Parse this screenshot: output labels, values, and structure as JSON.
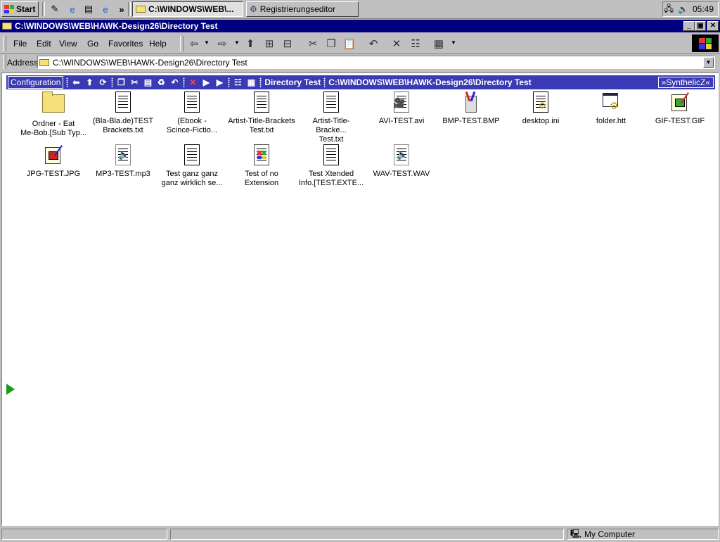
{
  "taskbar": {
    "start_label": "Start",
    "tasks": [
      {
        "label": "C:\\WINDOWS\\WEB\\..."
      },
      {
        "label": "Registrierungseditor"
      }
    ],
    "clock": "05:49",
    "more_glyph": "»"
  },
  "window": {
    "title": "C:\\WINDOWS\\WEB\\HAWK-Design26\\Directory Test",
    "minimize": "_",
    "maximize": "▣",
    "close": "✕"
  },
  "menu": {
    "file": "File",
    "edit": "Edit",
    "view": "View",
    "go": "Go",
    "favorites": "Favorites",
    "help": "Help"
  },
  "address": {
    "label": "Address",
    "value": "C:\\WINDOWS\\WEB\\HAWK-Design26\\Directory Test"
  },
  "hawkbar": {
    "config_label": "Configuration",
    "folder_name": "Directory Test",
    "folder_path": "C:\\WINDOWS\\WEB\\HAWK-Design26\\Directory Test",
    "brand_label": "»SynthelicZ«"
  },
  "files": [
    {
      "line1": "Ordner - Eat",
      "line2": "Me-Bob.[Sub Typ...",
      "icon": "folder-icon"
    },
    {
      "line1": "(Bla-Bla.de)TEST",
      "line2": "Brackets.txt",
      "icon": "text-file-icon"
    },
    {
      "line1": "(Ebook -",
      "line2": "Scince-Fictio...",
      "icon": "text-file-icon"
    },
    {
      "line1": "Artist-Title-Brackets",
      "line2": "Test.txt",
      "icon": "text-file-icon"
    },
    {
      "line1": "Artist-Title-Bracke...",
      "line2": "Test.txt",
      "icon": "text-file-icon"
    },
    {
      "line1": "AVI-TEST.avi",
      "line2": "",
      "icon": "video-file-icon"
    },
    {
      "line1": "BMP-TEST.BMP",
      "line2": "",
      "icon": "paint-file-icon"
    },
    {
      "line1": "desktop.ini",
      "line2": "",
      "icon": "settings-file-icon"
    },
    {
      "line1": "folder.htt",
      "line2": "",
      "icon": "htt-file-icon"
    },
    {
      "line1": "GIF-TEST.GIF",
      "line2": "",
      "icon": "image-file-icon"
    },
    {
      "line1": "JPG-TEST.JPG",
      "line2": "",
      "icon": "image-file-icon"
    },
    {
      "line1": "MP3-TEST.mp3",
      "line2": "",
      "icon": "audio-file-icon"
    },
    {
      "line1": "Test ganz ganz",
      "line2": "ganz wirklich se...",
      "icon": "text-file-icon"
    },
    {
      "line1": "Test of no",
      "line2": "Extension",
      "icon": "windows-file-icon"
    },
    {
      "line1": "Test Xtended",
      "line2": "Info.[TEST.EXTE...",
      "icon": "text-file-icon"
    },
    {
      "line1": "WAV-TEST.WAV",
      "line2": "",
      "icon": "audio-file-icon"
    }
  ],
  "status": {
    "zone": "My Computer"
  },
  "colors": {
    "title_bar": "#000080",
    "hawk_bar": "#3a3ab4",
    "folder": "#f6e07a"
  }
}
